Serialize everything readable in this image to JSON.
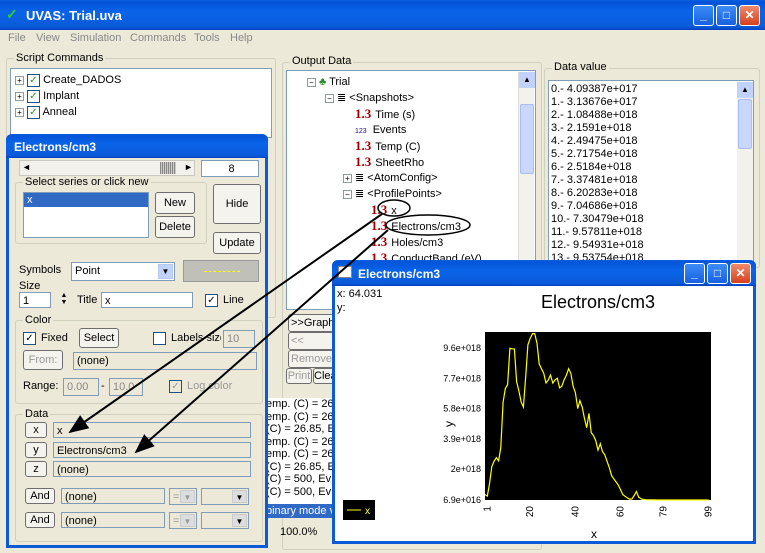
{
  "main": {
    "title": "UVAS: Trial.uva"
  },
  "menu": [
    "File",
    "View",
    "Simulation",
    "Commands",
    "Tools",
    "Help"
  ],
  "script_commands": {
    "label": "Script Commands",
    "items": [
      "Create_DADOS",
      "Implant",
      "Anneal"
    ]
  },
  "output_data": {
    "label": "Output Data",
    "tree": {
      "trial": "Trial",
      "snapshots": "<Snapshots>",
      "time": "Time (s)",
      "events": "Events",
      "temp": "Temp (C)",
      "sheetrho": "SheetRho",
      "atomconfig": "<AtomConfig>",
      "profilepoints": "<ProfilePoints>",
      "x": "x",
      "electrons": "Electrons/cm3",
      "holes": "Holes/cm3",
      "conductband": "ConductBand (eV)"
    },
    "buttons": {
      "graph": ">>Graph",
      "graph2": "<< Graph",
      "remove": "Remove",
      "print": "Print",
      "clear": "Clea"
    },
    "log_lines": [
      "emp. (C) = 26",
      "emp. (C) = 26",
      "(C) = 26.85, E",
      "emp. (C) = 26",
      "emp. (C) = 26",
      "(C) = 26.85, E",
      "(C) = 500, Ev",
      "(C) = 500, Ev"
    ],
    "status": "binary mode v",
    "zoom": "100.0%"
  },
  "data_value": {
    "label": "Data value",
    "rows": [
      "0.-  4.09387e+017",
      "1.-  3.13676e+017",
      "2.-  1.08488e+018",
      "3.-  2.1591e+018",
      "4.-  2.49475e+018",
      "5.-  2.71754e+018",
      "6.-  2.5184e+018",
      "7.-  3.37481e+018",
      "8.-  6.20283e+018",
      "9.-  7.04686e+018",
      "10.-  7.30479e+018",
      "11.-  9.57811e+018",
      "12.-  9.54931e+018",
      "13.-  9.53754e+018"
    ]
  },
  "series_window": {
    "title": "Electrons/cm3",
    "scroll_value": "8",
    "select_label": "Select series or click new",
    "series_list": [
      "x"
    ],
    "new": "New",
    "delete": "Delete",
    "hide": "Hide",
    "update": "Update",
    "symbols_label": "Symbols",
    "symbols_value": "Point",
    "size_label": "Size",
    "size_value": "1",
    "title_label": "Title",
    "title_value": "x",
    "line_label": "Line",
    "color_label": "Color",
    "fixed_label": "Fixed",
    "select_btn": "Select",
    "labels_size_label": "Labels size",
    "labels_size_value": "10",
    "from_btn": "From:",
    "from_value": "(none)",
    "range_label": "Range:",
    "range_min": "0.00",
    "range_max": "10.0",
    "logcolor_label": "Log color",
    "data_label": "Data",
    "x_btn": "x",
    "x_value": "x",
    "y_btn": "y",
    "y_value": "Electrons/cm3",
    "z_btn": "z",
    "z_value": "(none)",
    "and_btn": "And",
    "and1_value": "(none)",
    "and2_value": "(none)",
    "op": "="
  },
  "graph_window": {
    "title": "Electrons/cm3",
    "coord_x": "x: 64.031",
    "coord_y": "y:",
    "legend": "x"
  },
  "colors": {
    "plot_bg": "#000000",
    "series": "#ffff00",
    "titlebar": "#0a5fe0"
  },
  "chart_data": {
    "type": "line",
    "title": "Electrons/cm3",
    "xlabel": "x",
    "ylabel": "y",
    "xlim": [
      0,
      100
    ],
    "ylim": [
      6.9e+16,
      1.06e+19
    ],
    "x_ticks": [
      "1",
      "20",
      "40",
      "60",
      "79",
      "99"
    ],
    "y_ticks": [
      "6.9e+016",
      "2e+018",
      "3.9e+018",
      "5.8e+018",
      "7.7e+018",
      "9.6e+018"
    ],
    "x_tick_values": [
      1,
      20,
      40,
      60,
      79,
      99
    ],
    "y_tick_values": [
      6.9e+16,
      2e+18,
      3.9e+18,
      5.8e+18,
      7.7e+18,
      9.6e+18
    ],
    "legend": "top-left",
    "series": [
      {
        "name": "x",
        "x": [
          0,
          1,
          2,
          3,
          4,
          5,
          6,
          7,
          8,
          9,
          10,
          11,
          12,
          13,
          14,
          15,
          16,
          17,
          18,
          19,
          20,
          21,
          22,
          23,
          24,
          25,
          26,
          27,
          28,
          29,
          30,
          31,
          32,
          33,
          34,
          35,
          36,
          37,
          38,
          39,
          40,
          41,
          42,
          43,
          44,
          45,
          46,
          47,
          48,
          49,
          50,
          51,
          52,
          53,
          54,
          55,
          56,
          57,
          58,
          59,
          60,
          61,
          62,
          63,
          64,
          65,
          66,
          67,
          68,
          69,
          70,
          71,
          72,
          73,
          74,
          75,
          76,
          77,
          78,
          79,
          80,
          81,
          82,
          83,
          84,
          85,
          86,
          87,
          88,
          89,
          90,
          91,
          92,
          93,
          94,
          95,
          96,
          97,
          98,
          99
        ],
        "y": [
          4.09e+17,
          3.14e+17,
          1.08e+18,
          2.16e+18,
          2.49e+18,
          2.72e+18,
          2.52e+18,
          3.37e+18,
          6.2e+18,
          7.05e+18,
          7.3e+18,
          9.58e+18,
          9.55e+18,
          9.54e+18,
          7.5e+18,
          6.9e+18,
          6.2e+18,
          5.9e+18,
          7.8e+18,
          9.8e+18,
          1.02e+19,
          1.05e+19,
          1.05e+19,
          9.9e+18,
          8.6e+18,
          8.3e+18,
          8e+18,
          7.4e+18,
          7.6e+18,
          7.9e+18,
          7.4e+18,
          7.6e+18,
          7.7e+18,
          7.1e+18,
          7.2e+18,
          7.6e+18,
          7.9e+18,
          8.3e+18,
          8e+18,
          7.2e+18,
          6.8e+18,
          5.8e+18,
          6.3e+18,
          5.9e+18,
          5.2e+18,
          4.6e+18,
          5.5e+18,
          4.3e+18,
          4.1e+18,
          3.8e+18,
          3.2e+18,
          3.6e+18,
          3.1e+18,
          2.9e+18,
          2.5e+18,
          2.1e+18,
          1.6e+18,
          1.4e+18,
          1.2e+18,
          1e+18,
          7e+17,
          4e+17,
          3e+17,
          2e+17,
          1.2e+17,
          1.4e+17,
          3.5e+17,
          6e+17,
          2.5e+17,
          1.5e+17,
          1e+17,
          9e+16,
          8e+16,
          8e+16,
          7.5e+16,
          7.5e+16,
          7.2e+16,
          7e+16,
          7e+16,
          7e+16,
          7e+16,
          7e+16,
          7e+16,
          7e+16,
          7e+16,
          7e+16,
          6.9e+16,
          6.9e+16,
          6.9e+16,
          6.9e+16,
          6.9e+16,
          6.9e+16,
          6.9e+16,
          6.9e+16,
          6.9e+16,
          6.9e+16,
          6.9e+16,
          6.9e+16,
          6.9e+16,
          6.9e+16
        ]
      }
    ]
  }
}
